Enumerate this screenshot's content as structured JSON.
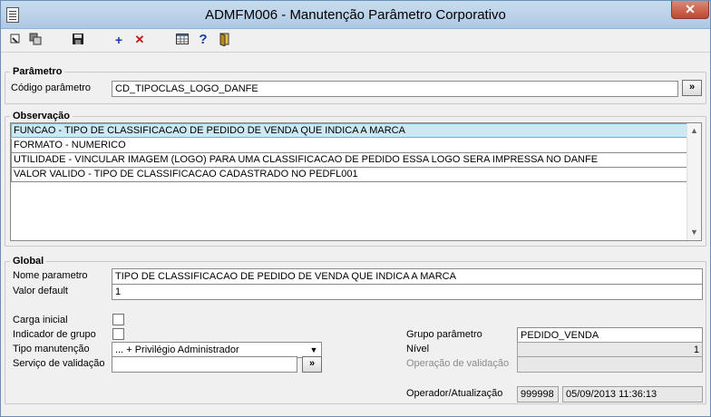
{
  "window": {
    "title": "ADMFM006 - Manutenção Parâmetro Corporativo"
  },
  "toolbar": {
    "icons": [
      "first-record-icon",
      "copy-icon",
      "save-icon",
      "add-icon",
      "delete-icon",
      "grid-icon",
      "help-icon",
      "exit-icon"
    ],
    "add_glyph": "+",
    "delete_glyph": "✕",
    "help_glyph": "?"
  },
  "parametro": {
    "group_title": "Parâmetro",
    "codigo_label": "Código parâmetro",
    "codigo_value": "CD_TIPOCLAS_LOGO_DANFE",
    "lookup_glyph": "»"
  },
  "observacao": {
    "group_title": "Observação",
    "lines": [
      "FUNCAO - TIPO DE CLASSIFICACAO DE PEDIDO DE VENDA QUE INDICA A MARCA",
      "FORMATO - NUMERICO",
      "UTILIDADE - VINCULAR IMAGEM (LOGO) PARA UMA CLASSIFICACAO DE PEDIDO ESSA LOGO SERA IMPRESSA NO DANFE",
      "VALOR VALIDO - TIPO DE CLASSIFICACAO CADASTRADO NO PEDFL001"
    ]
  },
  "global": {
    "group_title": "Global",
    "nome_label": "Nome parametro",
    "nome_value": "TIPO DE CLASSIFICACAO DE PEDIDO DE VENDA QUE INDICA A MARCA",
    "default_label": "Valor default",
    "default_value": "1",
    "carga_label": "Carga inicial",
    "indicador_label": "Indicador de grupo",
    "tipo_label": "Tipo manutenção",
    "tipo_value": "... + Privilégio Administrador",
    "servico_label": "Serviço de validação",
    "servico_value": "",
    "lookup_glyph": "»",
    "grupo_label": "Grupo parâmetro",
    "grupo_value": "PEDIDO_VENDA",
    "nivel_label": "Nível",
    "nivel_value": "1",
    "operacao_label": "Operação de validação",
    "operacao_value": "",
    "operador_label": "Operador/Atualização",
    "operador_value": "999998",
    "atualizacao_value": "05/09/2013 11:36:13"
  }
}
